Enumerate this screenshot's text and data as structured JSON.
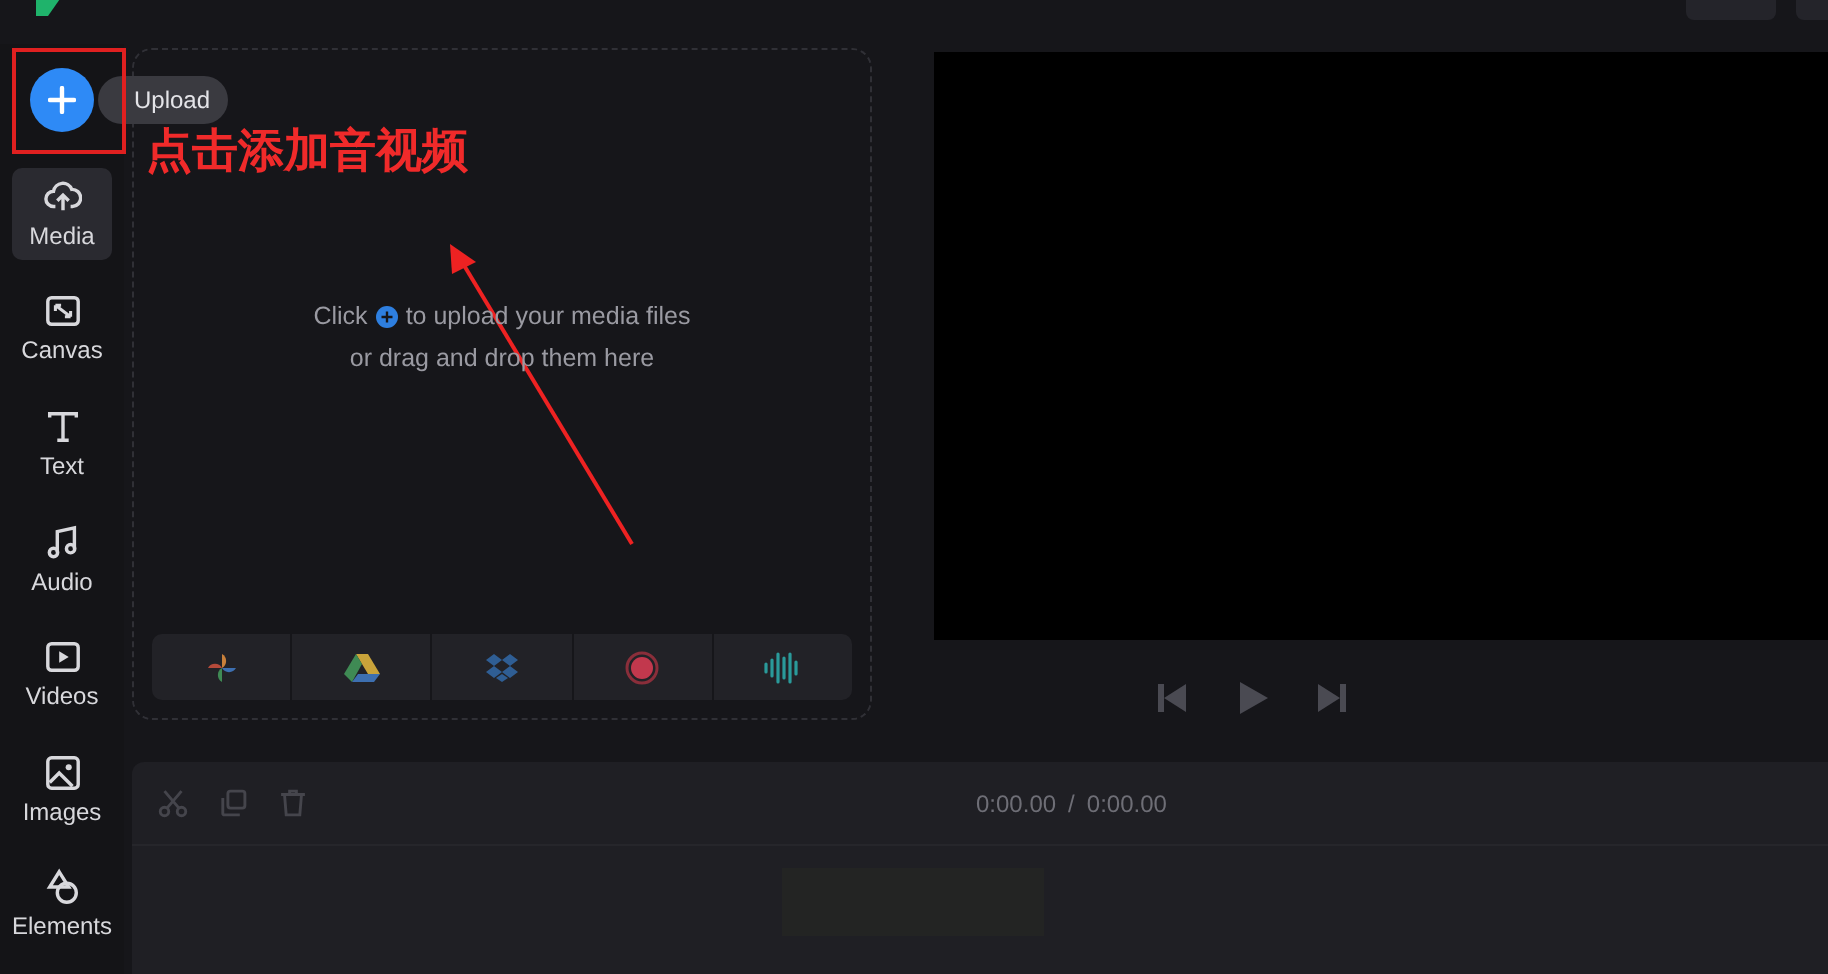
{
  "sidebar": {
    "upload_button": {
      "tooltip": "Upload"
    },
    "items": [
      {
        "kind": "media",
        "label": "Media",
        "selected": true
      },
      {
        "kind": "canvas",
        "label": "Canvas",
        "selected": false
      },
      {
        "kind": "text",
        "label": "Text",
        "selected": false
      },
      {
        "kind": "audio",
        "label": "Audio",
        "selected": false
      },
      {
        "kind": "videos",
        "label": "Videos",
        "selected": false
      },
      {
        "kind": "images",
        "label": "Images",
        "selected": false
      },
      {
        "kind": "elements",
        "label": "Elements",
        "selected": false
      }
    ]
  },
  "media_panel": {
    "hint_before": "Click",
    "hint_after": "to upload your media files",
    "hint_line2": "or drag and drop them here",
    "sources": [
      {
        "kind": "photos"
      },
      {
        "kind": "drive"
      },
      {
        "kind": "dropbox"
      },
      {
        "kind": "record"
      },
      {
        "kind": "audio"
      }
    ]
  },
  "timeline": {
    "current_time": "0:00.00",
    "separator": "/",
    "total_time": "0:00.00"
  },
  "annotation": {
    "text": "点击添加音视频"
  }
}
